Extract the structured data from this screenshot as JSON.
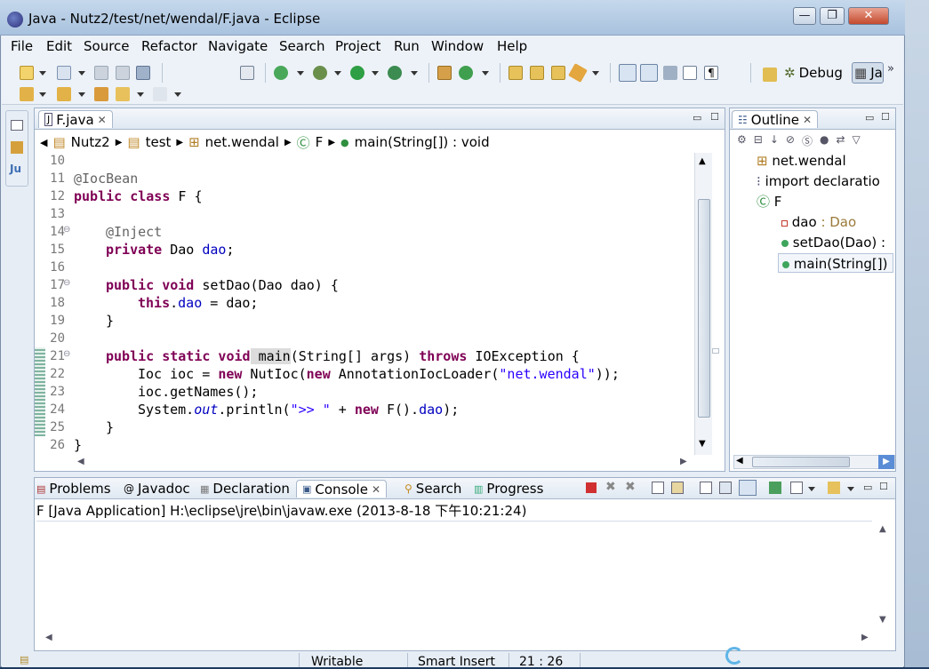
{
  "window": {
    "title": "Java - Nutz2/test/net/wendal/F.java - Eclipse"
  },
  "menu": [
    "File",
    "Edit",
    "Source",
    "Refactor",
    "Navigate",
    "Search",
    "Project",
    "Run",
    "Window",
    "Help"
  ],
  "perspectives": {
    "debug": "Debug",
    "java": "Ja"
  },
  "editor": {
    "tab_label": "F.java",
    "breadcrumb": [
      "Nutz2",
      "test",
      "net.wendal",
      "F",
      "main(String[]) : void"
    ],
    "lines": [
      {
        "n": "10"
      },
      {
        "n": "11"
      },
      {
        "n": "12"
      },
      {
        "n": "13"
      },
      {
        "n": "14"
      },
      {
        "n": "15"
      },
      {
        "n": "16"
      },
      {
        "n": "17"
      },
      {
        "n": "18"
      },
      {
        "n": "19"
      },
      {
        "n": "20"
      },
      {
        "n": "21"
      },
      {
        "n": "22"
      },
      {
        "n": "23"
      },
      {
        "n": "24"
      },
      {
        "n": "25"
      },
      {
        "n": "26"
      }
    ],
    "code": {
      "l11_ann": "@IocBean",
      "l12_kw": "public class",
      "l12_rest": " F {",
      "l14_ann": "@Inject",
      "l15_kw": "private",
      "l15_type": " Dao ",
      "l15_fld": "dao",
      "l15_end": ";",
      "l17_kw": "public void",
      "l17_rest": " setDao(Dao dao) {",
      "l18_kw": "this",
      "l18_dot": ".",
      "l18_fld": "dao",
      "l18_rest": " = dao;",
      "l19": "}",
      "l21_kw": "public static void",
      "l21_name": " main",
      "l21_rest": "(String[] args) ",
      "l21_kw2": "throws",
      "l21_rest2": " IOException {",
      "l22_a": "Ioc ioc = ",
      "l22_kw": "new",
      "l22_b": " NutIoc(",
      "l22_kw2": "new",
      "l22_c": " AnnotationIocLoader(",
      "l22_str": "\"net.wendal\"",
      "l22_d": "));",
      "l23": "ioc.getNames();",
      "l24_a": "System.",
      "l24_out": "out",
      "l24_b": ".println(",
      "l24_str": "\">> \"",
      "l24_c": " + ",
      "l24_kw": "new",
      "l24_d": " F().",
      "l24_fld": "dao",
      "l24_e": ");",
      "l25": "}",
      "l26": "}"
    }
  },
  "outline": {
    "tab_label": "Outline",
    "items": [
      {
        "label": "net.wendal"
      },
      {
        "label": "import declaratio"
      },
      {
        "label": "F"
      },
      {
        "label": "dao",
        "type": " : Dao"
      },
      {
        "label": "setDao(Dao) :"
      },
      {
        "label": "main(String[])"
      }
    ]
  },
  "bottom_tabs": [
    "Problems",
    "Javadoc",
    "Declaration",
    "Console",
    "Search",
    "Progress"
  ],
  "console": {
    "header": "F [Java Application] H:\\eclipse\\jre\\bin\\javaw.exe (2013-8-18 下午10:21:24)"
  },
  "status": {
    "writable": "Writable",
    "insert_mode": "Smart Insert",
    "position": "21 : 26"
  },
  "colors": {
    "keyword": "#7f0055",
    "annotation": "#646464",
    "field": "#0000c0",
    "string": "#2a00ff"
  }
}
